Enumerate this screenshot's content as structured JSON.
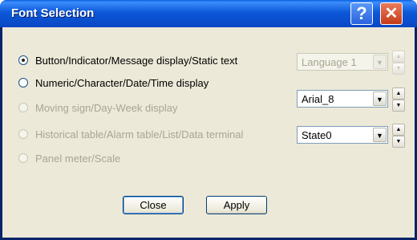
{
  "window": {
    "title": "Font Selection"
  },
  "titlebar": {
    "help_glyph": "?",
    "close_glyph": "✕"
  },
  "options": [
    {
      "label": "Button/Indicator/Message display/Static text",
      "selected": true,
      "enabled": true
    },
    {
      "label": "Numeric/Character/Date/Time display",
      "selected": false,
      "enabled": true
    },
    {
      "label": "Moving sign/Day-Week display",
      "selected": false,
      "enabled": false
    },
    {
      "label": "Historical table/Alarm table/List/Data terminal",
      "selected": false,
      "enabled": false
    },
    {
      "label": "Panel meter/Scale",
      "selected": false,
      "enabled": false
    }
  ],
  "combos": [
    {
      "value": "Language 1",
      "enabled": false
    },
    {
      "value": "Arial_8",
      "enabled": true
    },
    {
      "value": "State0",
      "enabled": true
    }
  ],
  "buttons": {
    "close_label": "Close",
    "apply_label": "Apply"
  },
  "glyphs": {
    "dropdown": "▼",
    "up": "▲",
    "down": "▼"
  }
}
